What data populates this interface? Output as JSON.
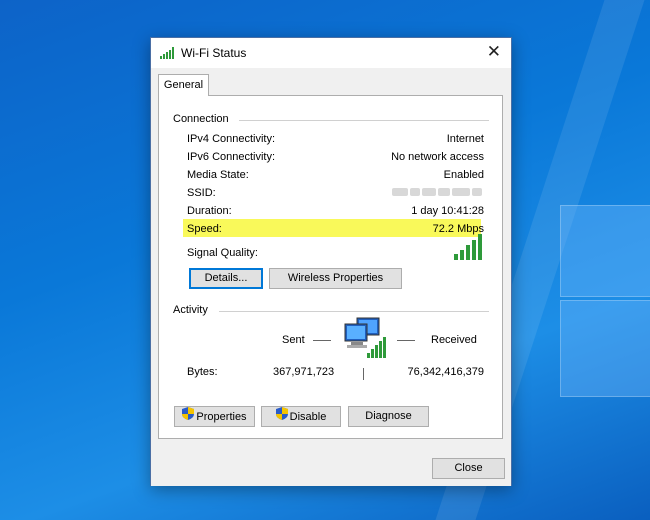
{
  "window": {
    "title": "Wi-Fi Status",
    "close_glyph": "✕"
  },
  "tabs": [
    {
      "label": "General"
    }
  ],
  "connection": {
    "group_label": "Connection",
    "rows": [
      {
        "label": "IPv4 Connectivity:",
        "value": "Internet"
      },
      {
        "label": "IPv6 Connectivity:",
        "value": "No network access"
      },
      {
        "label": "Media State:",
        "value": "Enabled"
      },
      {
        "label": "SSID:",
        "value": ""
      },
      {
        "label": "Duration:",
        "value": "1 day 10:41:28"
      },
      {
        "label": "Speed:",
        "value": "72.2 Mbps"
      }
    ],
    "signal_label": "Signal Quality:",
    "signal_bars": 5,
    "highlight_color": "#f9f95a"
  },
  "connection_buttons": {
    "details": "Details...",
    "wireless_properties": "Wireless Properties"
  },
  "activity": {
    "group_label": "Activity",
    "sent_label": "Sent",
    "received_label": "Received",
    "bytes_label": "Bytes:",
    "bytes_sent": "367,971,723",
    "bytes_received": "76,342,416,379"
  },
  "activity_buttons": {
    "properties": "Properties",
    "disable": "Disable",
    "diagnose": "Diagnose"
  },
  "footer": {
    "close": "Close"
  },
  "icons": {
    "title": "wifi-signal-icon",
    "network": "network-computers-icon",
    "shield": "uac-shield-icon"
  },
  "colors": {
    "desktop": "#0a78d8",
    "signal_green": "#2e9a3a",
    "focus_blue": "#0078d7"
  }
}
